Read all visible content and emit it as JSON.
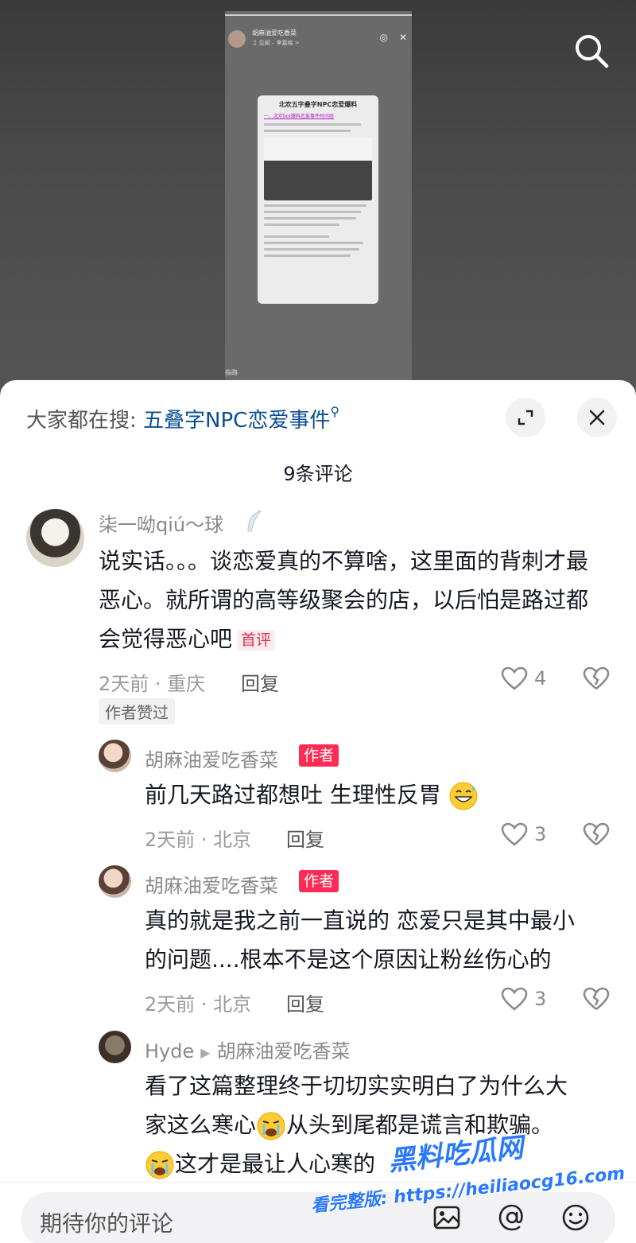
{
  "video": {
    "author": "胡麻油爱吃香菜",
    "music": "♫ 见闻 – 李嘉格 >",
    "doc_title": "北欢五字叠字NPC恋爱爆料",
    "doc_subtitle": "一、北欢bot爆料恋爱事件时间线",
    "footer_text": "指路"
  },
  "sheet": {
    "search_prefix": "大家都在搜: ",
    "search_keyword": "五叠字NPC恋爱事件",
    "comment_count": "9条评论"
  },
  "comments": [
    {
      "username": "柒一呦qiú～球",
      "text": "说实话。。。谈恋爱真的不算啥，这里面的背刺才最恶心。就所谓的高等级聚会的店，以后怕是路过都会觉得恶心吧",
      "first_tag": "首评",
      "meta": "2天前 · 重庆",
      "reply_label": "回复",
      "likes": "4",
      "liked_tag": "作者赞过"
    },
    {
      "username": "胡麻油爱吃香菜",
      "author_tag": "作者",
      "text": "前几天路过都想吐 生理性反胃",
      "meta": "2天前 · 北京",
      "reply_label": "回复",
      "likes": "3"
    },
    {
      "username": "胡麻油爱吃香菜",
      "author_tag": "作者",
      "text_line1": "真的就是我之前一直说的 恋爱只是其中最小",
      "text_line2": "的问题....根本不是这个原因让粉丝伤心的",
      "meta": "2天前 · 北京",
      "reply_label": "回复",
      "likes": "3"
    },
    {
      "username": "Hyde",
      "reply_to": "胡麻油爱吃香菜",
      "text_line1": "看了这篇整理终于切切实实明白了为什么大",
      "text_line2a": "家这么寒心",
      "text_line2b": "从头到尾都是谎言和欺骗。",
      "text_line3": "这才是最让人心寒的"
    }
  ],
  "input": {
    "placeholder": "期待你的评论"
  },
  "watermark": {
    "logo": "黑料吃瓜网",
    "url": "看完整版: https://heiliaocg16.com"
  },
  "colors": {
    "accent_red": "#fe2c55",
    "search_keyword_blue": "#0a4e94",
    "watermark_blue": "#2a78ff"
  }
}
